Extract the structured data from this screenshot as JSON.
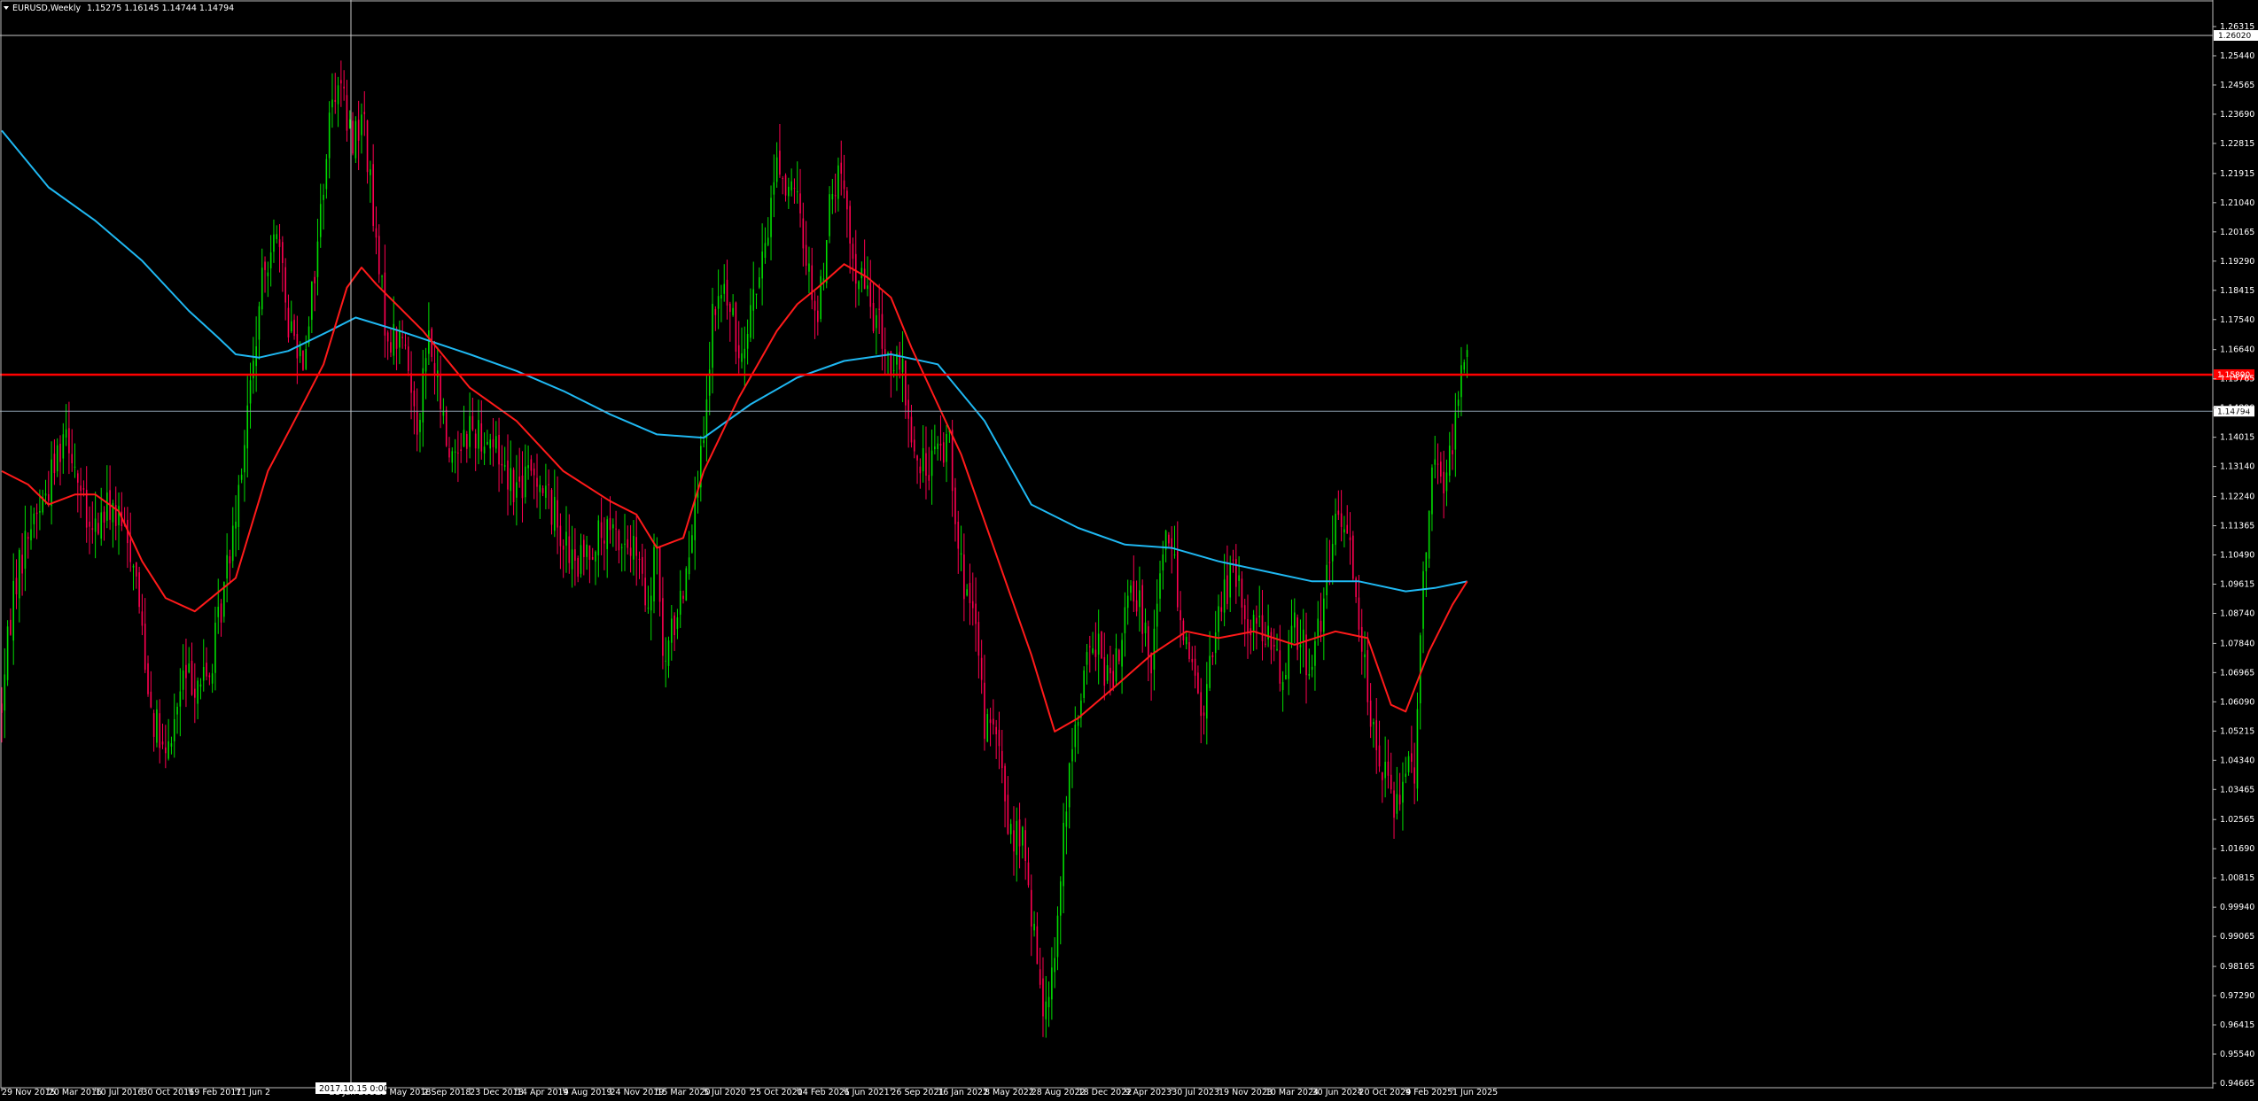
{
  "header": {
    "symbol_timeframe": "EURUSD,Weekly",
    "ohlc": "1.15275 1.16145 1.14744 1.14794"
  },
  "crosshair": {
    "time_label": "2017.10.15 0:00",
    "price_label": "1.26020"
  },
  "chart_data": {
    "type": "candlestick",
    "symbol": "EURUSD",
    "timeframe": "Weekly",
    "x_range": [
      "2015-11-29",
      "2025-07-06"
    ],
    "ylim": [
      0.94665,
      1.26315
    ],
    "y_ticks": [
      "1.26315",
      "1.25440",
      "1.24565",
      "1.23690",
      "1.22815",
      "1.21915",
      "1.21040",
      "1.20165",
      "1.19290",
      "1.18415",
      "1.17540",
      "1.16640",
      "1.15765",
      "1.14890",
      "1.14015",
      "1.13140",
      "1.12240",
      "1.11365",
      "1.10490",
      "1.09615",
      "1.08740",
      "1.07840",
      "1.06965",
      "1.06090",
      "1.05215",
      "1.04340",
      "1.03465",
      "1.02565",
      "1.01690",
      "1.00815",
      "0.99940",
      "0.99065",
      "0.98165",
      "0.97290",
      "0.96415",
      "0.95540",
      "0.94665"
    ],
    "x_ticks": [
      "29 Nov 2015",
      "20 Mar 2016",
      "10 Jul 2016",
      "30 Oct 2016",
      "19 Feb 2017",
      "11 Jun 2",
      "21 Jan 2018",
      "13 May 2018",
      "2 Sep 2018",
      "23 Dec 2018",
      "14 Apr 2019",
      "4 Aug 2019",
      "24 Nov 2019",
      "15 Mar 2020",
      "5 Jul 2020",
      "25 Oct 2020",
      "14 Feb 2021",
      "6 Jun 2021",
      "26 Sep 2021",
      "16 Jan 2022",
      "8 May 2022",
      "28 Aug 2022",
      "18 Dec 2022",
      "9 Apr 2023",
      "30 Jul 2023",
      "19 Nov 2023",
      "10 Mar 2024",
      "30 Jun 2024",
      "20 Oct 2024",
      "9 Feb 2025",
      "1 Jun 2025"
    ],
    "price_path": [
      [
        "2015-11-29",
        1.06
      ],
      [
        "2015-12-27",
        1.095
      ],
      [
        "2016-02-07",
        1.115
      ],
      [
        "2016-03-13",
        1.123
      ],
      [
        "2016-05-01",
        1.145
      ],
      [
        "2016-06-26",
        1.11
      ],
      [
        "2016-08-14",
        1.12
      ],
      [
        "2016-10-09",
        1.105
      ],
      [
        "2016-11-20",
        1.06
      ],
      [
        "2016-12-25",
        1.042
      ],
      [
        "2017-02-05",
        1.068
      ],
      [
        "2017-04-09",
        1.068
      ],
      [
        "2017-05-14",
        1.095
      ],
      [
        "2017-07-02",
        1.14
      ],
      [
        "2017-08-13",
        1.185
      ],
      [
        "2017-09-10",
        1.205
      ],
      [
        "2017-10-15",
        1.175
      ],
      [
        "2017-11-19",
        1.165
      ],
      [
        "2017-12-17",
        1.19
      ],
      [
        "2018-01-21",
        1.235
      ],
      [
        "2018-02-11",
        1.25
      ],
      [
        "2018-03-11",
        1.23
      ],
      [
        "2018-04-15",
        1.235
      ],
      [
        "2018-05-13",
        1.195
      ],
      [
        "2018-06-10",
        1.17
      ],
      [
        "2018-07-15",
        1.17
      ],
      [
        "2018-08-19",
        1.145
      ],
      [
        "2018-09-16",
        1.17
      ],
      [
        "2018-11-04",
        1.135
      ],
      [
        "2018-12-23",
        1.143
      ],
      [
        "2019-02-10",
        1.14
      ],
      [
        "2019-04-14",
        1.125
      ],
      [
        "2019-06-02",
        1.13
      ],
      [
        "2019-07-21",
        1.115
      ],
      [
        "2019-09-01",
        1.1
      ],
      [
        "2019-10-20",
        1.11
      ],
      [
        "2019-12-08",
        1.11
      ],
      [
        "2020-01-26",
        1.105
      ],
      [
        "2020-02-23",
        1.085
      ],
      [
        "2020-03-15",
        1.11
      ],
      [
        "2020-03-29",
        1.07
      ],
      [
        "2020-04-26",
        1.085
      ],
      [
        "2020-05-24",
        1.1
      ],
      [
        "2020-06-14",
        1.125
      ],
      [
        "2020-07-05",
        1.135
      ],
      [
        "2020-07-26",
        1.175
      ],
      [
        "2020-08-23",
        1.185
      ],
      [
        "2020-09-27",
        1.165
      ],
      [
        "2020-10-25",
        1.18
      ],
      [
        "2020-11-22",
        1.19
      ],
      [
        "2020-12-27",
        1.225
      ],
      [
        "2021-01-17",
        1.215
      ],
      [
        "2021-02-14",
        1.21
      ],
      [
        "2021-03-14",
        1.19
      ],
      [
        "2021-04-04",
        1.175
      ],
      [
        "2021-05-02",
        1.21
      ],
      [
        "2021-05-30",
        1.22
      ],
      [
        "2021-06-20",
        1.195
      ],
      [
        "2021-07-25",
        1.185
      ],
      [
        "2021-08-22",
        1.175
      ],
      [
        "2021-09-26",
        1.162
      ],
      [
        "2021-10-24",
        1.158
      ],
      [
        "2021-11-28",
        1.13
      ],
      [
        "2022-01-16",
        1.135
      ],
      [
        "2022-02-13",
        1.14
      ],
      [
        "2022-03-13",
        1.1
      ],
      [
        "2022-04-17",
        1.08
      ],
      [
        "2022-05-08",
        1.055
      ],
      [
        "2022-06-05",
        1.05
      ],
      [
        "2022-07-10",
        1.02
      ],
      [
        "2022-08-07",
        1.02
      ],
      [
        "2022-08-28",
        0.995
      ],
      [
        "2022-09-25",
        0.97
      ],
      [
        "2022-10-23",
        0.985
      ],
      [
        "2022-11-20",
        1.03
      ],
      [
        "2022-12-18",
        1.06
      ],
      [
        "2023-01-22",
        1.08
      ],
      [
        "2023-03-12",
        1.065
      ],
      [
        "2023-04-09",
        1.09
      ],
      [
        "2023-05-14",
        1.09
      ],
      [
        "2023-06-11",
        1.075
      ],
      [
        "2023-07-16",
        1.115
      ],
      [
        "2023-08-13",
        1.095
      ],
      [
        "2023-09-17",
        1.07
      ],
      [
        "2023-10-15",
        1.057
      ],
      [
        "2023-11-19",
        1.09
      ],
      [
        "2023-12-24",
        1.1
      ],
      [
        "2024-01-28",
        1.085
      ],
      [
        "2024-03-03",
        1.085
      ],
      [
        "2024-04-14",
        1.068
      ],
      [
        "2024-05-19",
        1.085
      ],
      [
        "2024-06-23",
        1.072
      ],
      [
        "2024-07-28",
        1.09
      ],
      [
        "2024-08-25",
        1.115
      ],
      [
        "2024-09-29",
        1.11
      ],
      [
        "2024-10-27",
        1.08
      ],
      [
        "2024-11-24",
        1.05
      ],
      [
        "2024-12-29",
        1.035
      ],
      [
        "2025-01-19",
        1.03
      ],
      [
        "2025-02-09",
        1.045
      ],
      [
        "2025-03-02",
        1.04
      ],
      [
        "2025-03-16",
        1.085
      ],
      [
        "2025-04-13",
        1.135
      ],
      [
        "2025-05-11",
        1.125
      ],
      [
        "2025-06-01",
        1.14
      ],
      [
        "2025-06-22",
        1.165
      ],
      [
        "2025-07-06",
        1.165
      ]
    ],
    "series": [
      {
        "name": "",
        "color": "#1fb8f2",
        "points": [
          [
            "2015-11-29",
            1.232
          ],
          [
            "2016-03-20",
            1.215
          ],
          [
            "2016-07-10",
            1.205
          ],
          [
            "2016-10-30",
            1.193
          ],
          [
            "2017-02-19",
            1.178
          ],
          [
            "2017-04-30",
            1.17
          ],
          [
            "2017-06-11",
            1.165
          ],
          [
            "2017-08-06",
            1.164
          ],
          [
            "2017-10-15",
            1.166
          ],
          [
            "2018-01-21",
            1.172
          ],
          [
            "2018-03-25",
            1.176
          ],
          [
            "2018-07-08",
            1.172
          ],
          [
            "2018-12-23",
            1.165
          ],
          [
            "2019-04-14",
            1.16
          ],
          [
            "2019-08-04",
            1.154
          ],
          [
            "2019-11-24",
            1.147
          ],
          [
            "2020-03-15",
            1.141
          ],
          [
            "2020-07-05",
            1.14
          ],
          [
            "2020-10-25",
            1.15
          ],
          [
            "2021-02-14",
            1.158
          ],
          [
            "2021-06-06",
            1.163
          ],
          [
            "2021-09-26",
            1.165
          ],
          [
            "2022-01-16",
            1.162
          ],
          [
            "2022-05-08",
            1.145
          ],
          [
            "2022-08-28",
            1.12
          ],
          [
            "2022-12-18",
            1.113
          ],
          [
            "2023-04-09",
            1.108
          ],
          [
            "2023-07-30",
            1.107
          ],
          [
            "2023-11-19",
            1.103
          ],
          [
            "2024-03-10",
            1.1
          ],
          [
            "2024-06-30",
            1.097
          ],
          [
            "2024-10-20",
            1.097
          ],
          [
            "2025-02-09",
            1.094
          ],
          [
            "2025-04-20",
            1.095
          ],
          [
            "2025-07-06",
            1.097
          ]
        ]
      },
      {
        "name": "",
        "color": "#ff1a1a",
        "points": [
          [
            "2015-11-29",
            1.13
          ],
          [
            "2016-01-31",
            1.126
          ],
          [
            "2016-03-20",
            1.12
          ],
          [
            "2016-05-22",
            1.123
          ],
          [
            "2016-07-10",
            1.123
          ],
          [
            "2016-09-04",
            1.118
          ],
          [
            "2016-10-30",
            1.103
          ],
          [
            "2016-12-25",
            1.092
          ],
          [
            "2017-03-05",
            1.088
          ],
          [
            "2017-06-11",
            1.098
          ],
          [
            "2017-08-27",
            1.13
          ],
          [
            "2017-10-29",
            1.145
          ],
          [
            "2018-01-07",
            1.162
          ],
          [
            "2018-03-04",
            1.185
          ],
          [
            "2018-04-08",
            1.191
          ],
          [
            "2018-05-13",
            1.186
          ],
          [
            "2018-09-02",
            1.172
          ],
          [
            "2018-12-23",
            1.155
          ],
          [
            "2019-04-14",
            1.145
          ],
          [
            "2019-08-04",
            1.13
          ],
          [
            "2019-11-24",
            1.121
          ],
          [
            "2020-01-26",
            1.117
          ],
          [
            "2020-03-15",
            1.107
          ],
          [
            "2020-05-17",
            1.11
          ],
          [
            "2020-07-05",
            1.13
          ],
          [
            "2020-09-27",
            1.152
          ],
          [
            "2020-12-27",
            1.172
          ],
          [
            "2021-02-14",
            1.18
          ],
          [
            "2021-04-04",
            1.185
          ],
          [
            "2021-06-06",
            1.192
          ],
          [
            "2021-08-01",
            1.188
          ],
          [
            "2021-09-26",
            1.182
          ],
          [
            "2021-11-14",
            1.167
          ],
          [
            "2022-01-16",
            1.15
          ],
          [
            "2022-03-13",
            1.135
          ],
          [
            "2022-05-08",
            1.115
          ],
          [
            "2022-08-28",
            1.075
          ],
          [
            "2022-10-23",
            1.052
          ],
          [
            "2022-12-18",
            1.056
          ],
          [
            "2023-03-12",
            1.065
          ],
          [
            "2023-06-11",
            1.075
          ],
          [
            "2023-09-03",
            1.082
          ],
          [
            "2023-11-19",
            1.08
          ],
          [
            "2024-02-11",
            1.082
          ],
          [
            "2024-05-19",
            1.078
          ],
          [
            "2024-08-25",
            1.082
          ],
          [
            "2024-11-10",
            1.08
          ],
          [
            "2025-01-05",
            1.06
          ],
          [
            "2025-02-09",
            1.058
          ],
          [
            "2025-04-06",
            1.076
          ],
          [
            "2025-06-01",
            1.09
          ],
          [
            "2025-07-06",
            1.097
          ]
        ]
      }
    ],
    "horizontal_lines": [
      {
        "price": 1.1589,
        "color": "#ff0000",
        "label": "1.15890"
      },
      {
        "price": 1.14794,
        "color": "#8ea0b0",
        "label": "1.14794"
      }
    ]
  },
  "colors": {
    "background": "#000000",
    "bull_candle": "#00dd00",
    "bear_candle": "#ff0050",
    "axis": "#c0c0c0",
    "text": "#ffffff"
  }
}
